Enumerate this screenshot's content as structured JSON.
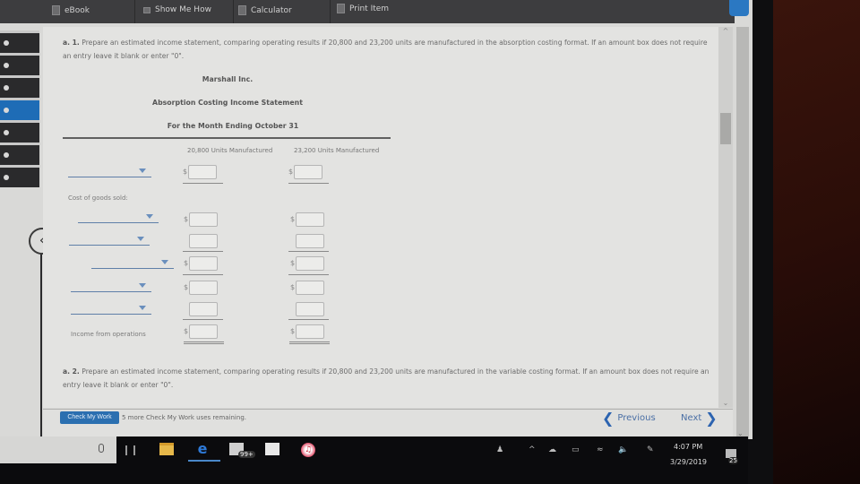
{
  "toolbar": {
    "items": [
      {
        "label": "eBook",
        "icon": "book-icon"
      },
      {
        "label": "Show Me How",
        "icon": "video-icon"
      },
      {
        "label": "Calculator",
        "icon": "calculator-icon"
      },
      {
        "label": "Print Item",
        "icon": "print-icon"
      }
    ]
  },
  "nav": {
    "items": 7,
    "active_index": 3,
    "back_icon": "chevron-left-icon"
  },
  "question_a1": {
    "prefix": "a. 1.",
    "text": "Prepare an estimated income statement, comparing operating results if 20,800 and 23,200 units are manufactured in the absorption costing format. If an amount box does not require an entry leave it blank or enter \"0\"."
  },
  "statement": {
    "company": "Marshall Inc.",
    "title": "Absorption Costing Income Statement",
    "period": "For the Month Ending October 31",
    "columns": [
      "20,800 Units Manufactured",
      "23,200 Units Manufactured"
    ],
    "currency_symbol": "$",
    "labels": {
      "cogs": "Cost of goods sold:",
      "income": "Income from operations"
    },
    "rows": [
      {
        "type": "dropdown",
        "value": "",
        "col1": "",
        "col2": ""
      },
      {
        "type": "dropdown",
        "value": "",
        "col1": "",
        "col2": ""
      },
      {
        "type": "dropdown",
        "value": "",
        "col1": "",
        "col2": ""
      },
      {
        "type": "dropdown",
        "value": "",
        "col1": "",
        "col2": ""
      },
      {
        "type": "dropdown",
        "value": "",
        "col1": "",
        "col2": ""
      },
      {
        "type": "dropdown",
        "value": "",
        "col1": "",
        "col2": ""
      },
      {
        "type": "label",
        "value": "Income from operations",
        "col1": "",
        "col2": ""
      }
    ]
  },
  "question_a2": {
    "prefix": "a. 2.",
    "text": "Prepare an estimated income statement, comparing operating results if 20,800 and 23,200 units are manufactured in the variable costing format. If an amount box does not require an entry leave it blank or enter \"0\"."
  },
  "footer": {
    "check_label": "Check My Work",
    "check_note": "5 more Check My Work uses remaining.",
    "previous_label": "Previous",
    "next_label": "Next"
  },
  "taskbar": {
    "apps": [
      "file-explorer",
      "edge",
      "mail",
      "store",
      "itunes"
    ],
    "mail_badge": "99+",
    "time": "4:07 PM",
    "date": "3/29/2019",
    "notification_count": "25"
  },
  "colors": {
    "accent": "#2b6fb0",
    "nav_active": "#1e6cb6",
    "toolbar": "#3d3d3f"
  }
}
